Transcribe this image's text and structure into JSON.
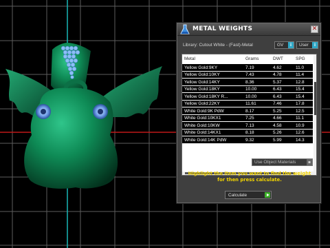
{
  "panel": {
    "title": "METAL WEIGHTS",
    "close_icon": "close-icon",
    "flask_icon": "flask-icon",
    "library_label": "Library: Cutout White - (Fast)-Metal",
    "option_gv": "GV",
    "option_gv_btn": "i",
    "option_user": "User",
    "option_user_btn": "i",
    "columns": [
      "Metal",
      "Grams",
      "DWT",
      "SPG"
    ],
    "rows": [
      {
        "metal": "Yellow Gold:9KY",
        "grams": "7.19",
        "dwt": "4.62",
        "spg": "11.0"
      },
      {
        "metal": "Yellow Gold:10KY",
        "grams": "7.43",
        "dwt": "4.78",
        "spg": "11.4"
      },
      {
        "metal": "Yellow Gold:14KY",
        "grams": "8.36",
        "dwt": "5.37",
        "spg": "12.8"
      },
      {
        "metal": "Yellow Gold:18KY",
        "grams": "10.00",
        "dwt": "6.43",
        "spg": "15.4"
      },
      {
        "metal": "Yellow Gold:18KY R...",
        "grams": "10.00",
        "dwt": "6.43",
        "spg": "15.4"
      },
      {
        "metal": "Yellow Gold:22KY",
        "grams": "11.61",
        "dwt": "7.46",
        "spg": "17.8"
      },
      {
        "metal": "White Gold:9K PdW",
        "grams": "8.17",
        "dwt": "5.25",
        "spg": "12.5"
      },
      {
        "metal": "White Gold:10KX1",
        "grams": "7.25",
        "dwt": "4.66",
        "spg": "11.1"
      },
      {
        "metal": "White Gold:10KW",
        "grams": "7.13",
        "dwt": "4.58",
        "spg": "10.9"
      },
      {
        "metal": "White Gold:14KX1",
        "grams": "8.18",
        "dwt": "5.26",
        "spg": "12.6"
      },
      {
        "metal": "White Gold:14K PdW",
        "grams": "9.32",
        "dwt": "5.99",
        "spg": "14.3"
      }
    ],
    "use_materials_label": "Use Object Materials",
    "instruction": "Highlight the item you want to find the weight for then press calculate.",
    "calculate_label": "Calculate",
    "colors": {
      "panel_bg": "#3f3f3f",
      "instruction": "#f2d400",
      "accent_button": "#2fa7c6",
      "calc_arrow": "#3fb02c",
      "model": "#0f7a4a",
      "gem": "#7fb6f2"
    }
  }
}
